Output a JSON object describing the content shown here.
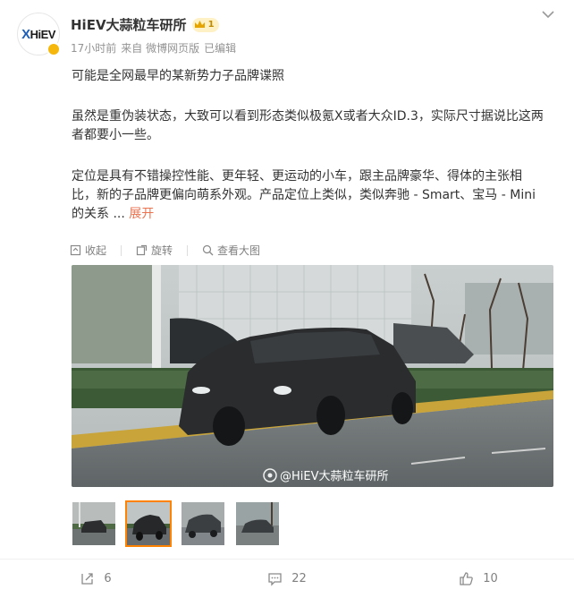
{
  "user": {
    "name": "HiEV大蒜粒车研所",
    "level": "1",
    "avatar_text_x": "X",
    "avatar_text": "HiEV"
  },
  "meta": {
    "time": "17小时前",
    "source": "来自 微博网页版",
    "edited": "已编辑"
  },
  "content": {
    "line1": "可能是全网最早的某新势力子品牌谍照",
    "line2": "虽然是重伪装状态，大致可以看到形态类似极氪X或者大众ID.3，实际尺寸据说比这两者都要小一些。",
    "line3": "定位是具有不错操控性能、更年轻、更运动的小车，跟主品牌豪华、得体的主张相比，新的子品牌更偏向萌系外观。产品定位上类似，类似奔驰 - Smart、宝马 - Mini的关系  ... ",
    "expand": "展开"
  },
  "toolbar": {
    "collapse": "收起",
    "rotate": "旋转",
    "view_large": "查看大图"
  },
  "photo": {
    "watermark": "@HiEV大蒜粒车研所"
  },
  "thumbnails": [
    "thumb-1",
    "thumb-2",
    "thumb-3",
    "thumb-4"
  ],
  "footer": {
    "repost": "6",
    "comment": "22",
    "like": "10"
  },
  "colors": {
    "accent": "#eb7350",
    "thumb_active": "#ff8200",
    "badge": "#f5b70b"
  }
}
